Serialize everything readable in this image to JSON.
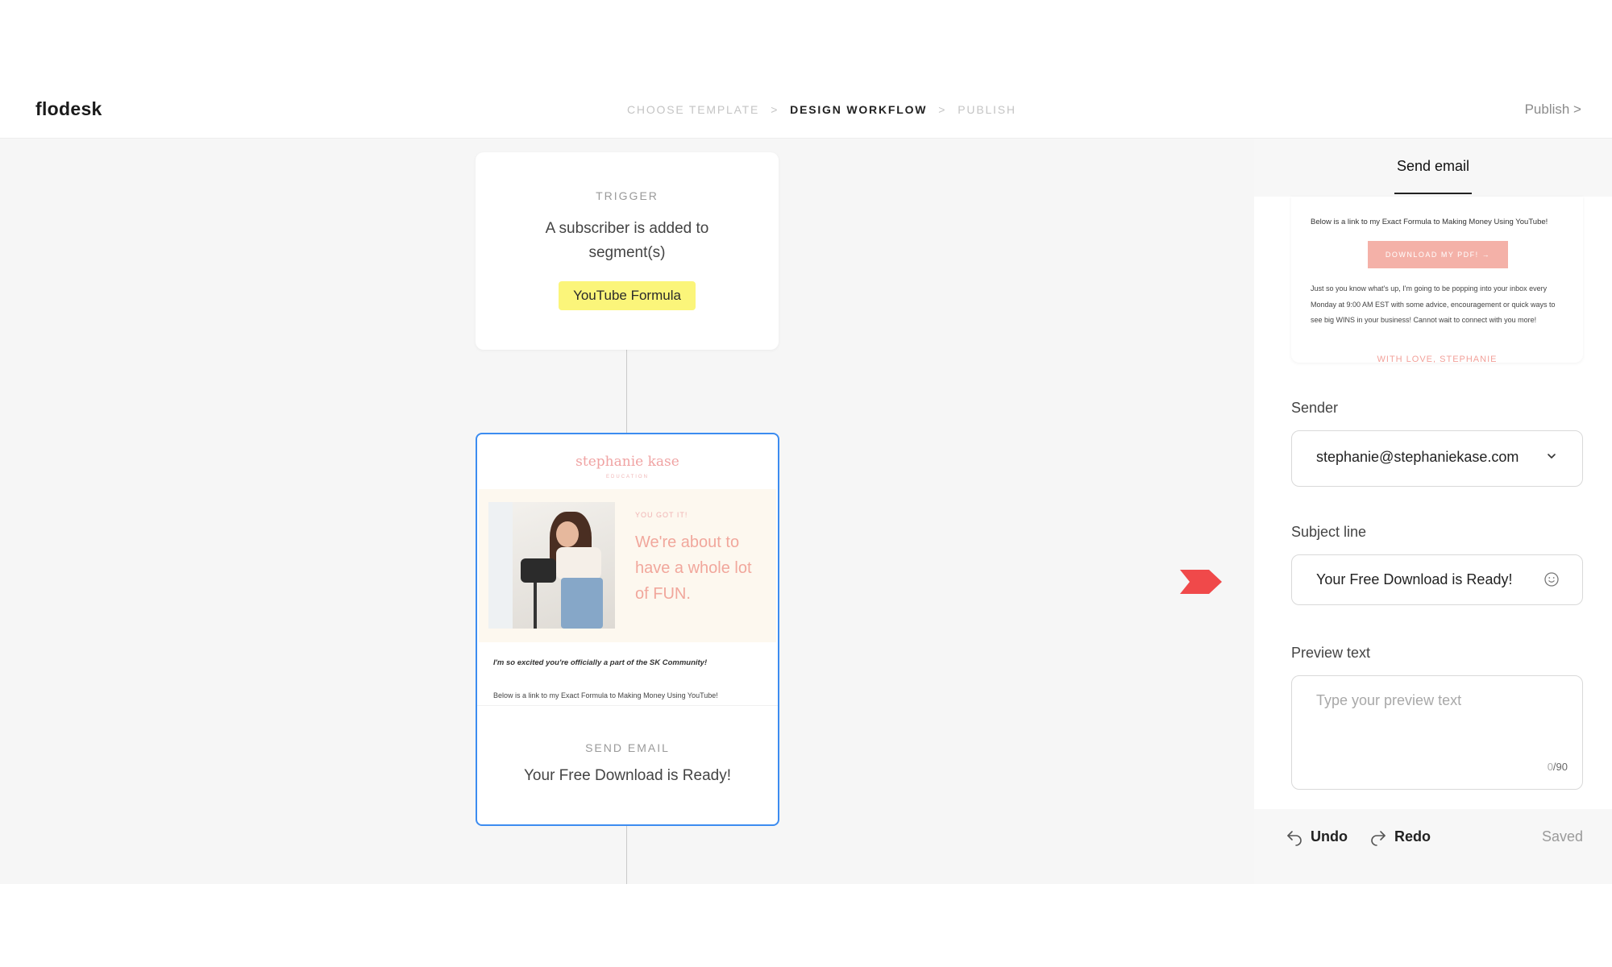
{
  "app": {
    "logo": "flodesk"
  },
  "breadcrumb": {
    "steps": [
      "CHOOSE TEMPLATE",
      "DESIGN WORKFLOW",
      "PUBLISH"
    ],
    "separator": ">",
    "active_index": 1
  },
  "header": {
    "publish_label": "Publish >"
  },
  "trigger": {
    "label": "TRIGGER",
    "text": "A subscriber is added to segment(s)",
    "segment": "YouTube Formula",
    "segment_color": "#fbf57a"
  },
  "email_card": {
    "brand": "stephanie kase",
    "brand_sub": "EDUCATION",
    "kicker": "YOU GOT IT!",
    "hero_title": "We're about to have a whole lot of FUN.",
    "line1": "I'm so excited you're officially a part of the SK Community!",
    "line2": "Below is a link to my Exact Formula to Making Money Using YouTube!",
    "label": "SEND EMAIL",
    "subject": "Your Free Download is Ready!",
    "accent_color": "#3c8cf0"
  },
  "panel": {
    "tab_label": "Send email",
    "preview": {
      "line1": "Below is a link to my Exact Formula to Making Money Using YouTube!",
      "button": "DOWNLOAD MY PDF! →",
      "paragraph": "Just so you know what's up, I'm going to be popping into your inbox every Monday at 9:00 AM EST with some advice, encouragement or quick ways to see big WINS in your business! Cannot wait to connect with you more!",
      "signoff": "WITH LOVE, STEPHANIE"
    },
    "sender": {
      "label": "Sender",
      "value": "stephanie@stephaniekase.com",
      "icon": "chevron-down-icon"
    },
    "subject": {
      "label": "Subject line",
      "value": "Your Free Download is Ready!",
      "icon": "emoji-icon"
    },
    "preview_text": {
      "label": "Preview text",
      "placeholder": "Type your preview text",
      "count": "0",
      "max": "/90"
    },
    "footer": {
      "undo": "Undo",
      "redo": "Redo",
      "status": "Saved"
    }
  },
  "colors": {
    "pointer": "#f0494a",
    "pink_button": "#f4b1a8"
  }
}
